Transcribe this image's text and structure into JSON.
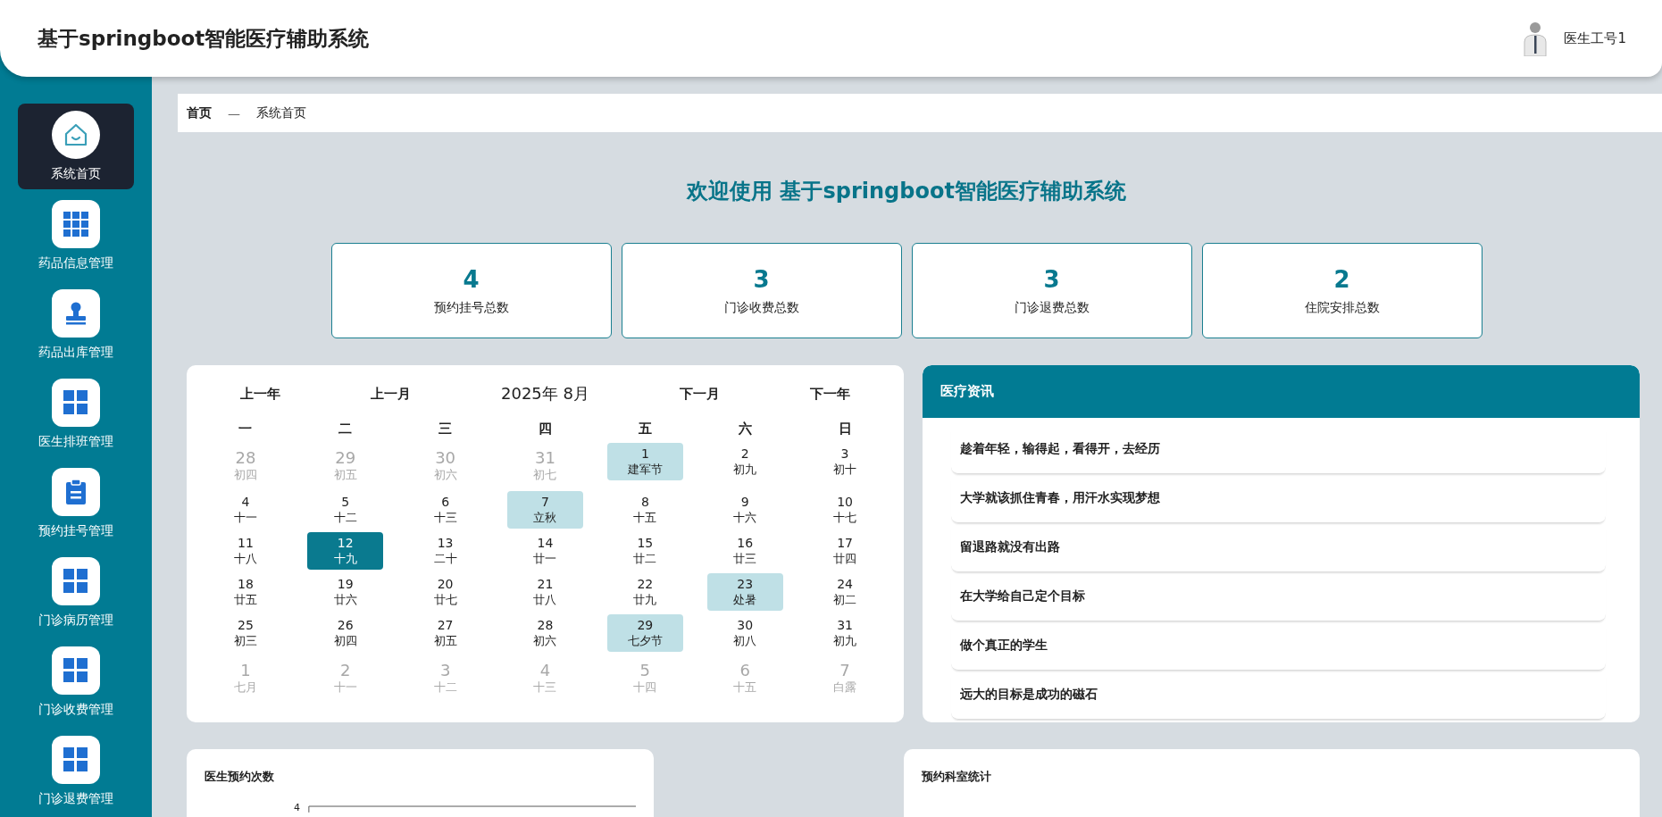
{
  "header": {
    "title": "基于springboot智能医疗辅助系统",
    "user": "医生工号1"
  },
  "sidebar": {
    "items": [
      {
        "label": "系统首页",
        "kind": "home",
        "selected": true
      },
      {
        "label": "药品信息管理",
        "kind": "grid9",
        "selected": false
      },
      {
        "label": "药品出库管理",
        "kind": "stamp",
        "selected": false
      },
      {
        "label": "医生排班管理",
        "kind": "grid4",
        "selected": false
      },
      {
        "label": "预约挂号管理",
        "kind": "clipboard",
        "selected": false
      },
      {
        "label": "门诊病历管理",
        "kind": "grid4",
        "selected": false
      },
      {
        "label": "门诊收费管理",
        "kind": "grid4",
        "selected": false
      },
      {
        "label": "门诊退费管理",
        "kind": "grid4",
        "selected": false
      }
    ]
  },
  "breadcrumb": {
    "current": "首页",
    "separator": "—",
    "page": "系统首页"
  },
  "welcome": "欢迎使用 基于springboot智能医疗辅助系统",
  "stats": [
    {
      "value": "4",
      "label": "预约挂号总数"
    },
    {
      "value": "3",
      "label": "门诊收费总数"
    },
    {
      "value": "3",
      "label": "门诊退费总数"
    },
    {
      "value": "2",
      "label": "住院安排总数"
    }
  ],
  "calendar": {
    "prev_year": "上一年",
    "prev_month": "上一月",
    "month": "2025年 8月",
    "next_month": "下一月",
    "next_year": "下一年",
    "weekdays": [
      "一",
      "二",
      "三",
      "四",
      "五",
      "六",
      "日"
    ],
    "days": [
      {
        "day": "28",
        "lunar": "初四",
        "muted": true,
        "festival": false,
        "selected": false
      },
      {
        "day": "29",
        "lunar": "初五",
        "muted": true,
        "festival": false,
        "selected": false
      },
      {
        "day": "30",
        "lunar": "初六",
        "muted": true,
        "festival": false,
        "selected": false
      },
      {
        "day": "31",
        "lunar": "初七",
        "muted": true,
        "festival": false,
        "selected": false
      },
      {
        "day": "1",
        "lunar": "建军节",
        "muted": false,
        "festival": true,
        "selected": false
      },
      {
        "day": "2",
        "lunar": "初九",
        "muted": false,
        "festival": false,
        "selected": false
      },
      {
        "day": "3",
        "lunar": "初十",
        "muted": false,
        "festival": false,
        "selected": false
      },
      {
        "day": "4",
        "lunar": "十一",
        "muted": false,
        "festival": false,
        "selected": false
      },
      {
        "day": "5",
        "lunar": "十二",
        "muted": false,
        "festival": false,
        "selected": false
      },
      {
        "day": "6",
        "lunar": "十三",
        "muted": false,
        "festival": false,
        "selected": false
      },
      {
        "day": "7",
        "lunar": "立秋",
        "muted": false,
        "festival": true,
        "selected": false
      },
      {
        "day": "8",
        "lunar": "十五",
        "muted": false,
        "festival": false,
        "selected": false
      },
      {
        "day": "9",
        "lunar": "十六",
        "muted": false,
        "festival": false,
        "selected": false
      },
      {
        "day": "10",
        "lunar": "十七",
        "muted": false,
        "festival": false,
        "selected": false
      },
      {
        "day": "11",
        "lunar": "十八",
        "muted": false,
        "festival": false,
        "selected": false
      },
      {
        "day": "12",
        "lunar": "十九",
        "muted": false,
        "festival": false,
        "selected": true
      },
      {
        "day": "13",
        "lunar": "二十",
        "muted": false,
        "festival": false,
        "selected": false
      },
      {
        "day": "14",
        "lunar": "廿一",
        "muted": false,
        "festival": false,
        "selected": false
      },
      {
        "day": "15",
        "lunar": "廿二",
        "muted": false,
        "festival": false,
        "selected": false
      },
      {
        "day": "16",
        "lunar": "廿三",
        "muted": false,
        "festival": false,
        "selected": false
      },
      {
        "day": "17",
        "lunar": "廿四",
        "muted": false,
        "festival": false,
        "selected": false
      },
      {
        "day": "18",
        "lunar": "廿五",
        "muted": false,
        "festival": false,
        "selected": false
      },
      {
        "day": "19",
        "lunar": "廿六",
        "muted": false,
        "festival": false,
        "selected": false
      },
      {
        "day": "20",
        "lunar": "廿七",
        "muted": false,
        "festival": false,
        "selected": false
      },
      {
        "day": "21",
        "lunar": "廿八",
        "muted": false,
        "festival": false,
        "selected": false
      },
      {
        "day": "22",
        "lunar": "廿九",
        "muted": false,
        "festival": false,
        "selected": false
      },
      {
        "day": "23",
        "lunar": "处暑",
        "muted": false,
        "festival": true,
        "selected": false
      },
      {
        "day": "24",
        "lunar": "初二",
        "muted": false,
        "festival": false,
        "selected": false
      },
      {
        "day": "25",
        "lunar": "初三",
        "muted": false,
        "festival": false,
        "selected": false
      },
      {
        "day": "26",
        "lunar": "初四",
        "muted": false,
        "festival": false,
        "selected": false
      },
      {
        "day": "27",
        "lunar": "初五",
        "muted": false,
        "festival": false,
        "selected": false
      },
      {
        "day": "28",
        "lunar": "初六",
        "muted": false,
        "festival": false,
        "selected": false
      },
      {
        "day": "29",
        "lunar": "七夕节",
        "muted": false,
        "festival": true,
        "selected": false
      },
      {
        "day": "30",
        "lunar": "初八",
        "muted": false,
        "festival": false,
        "selected": false
      },
      {
        "day": "31",
        "lunar": "初九",
        "muted": false,
        "festival": false,
        "selected": false
      },
      {
        "day": "1",
        "lunar": "七月",
        "muted": true,
        "festival": false,
        "selected": false
      },
      {
        "day": "2",
        "lunar": "十一",
        "muted": true,
        "festival": false,
        "selected": false
      },
      {
        "day": "3",
        "lunar": "十二",
        "muted": true,
        "festival": false,
        "selected": false
      },
      {
        "day": "4",
        "lunar": "十三",
        "muted": true,
        "festival": false,
        "selected": false
      },
      {
        "day": "5",
        "lunar": "十四",
        "muted": true,
        "festival": false,
        "selected": false
      },
      {
        "day": "6",
        "lunar": "十五",
        "muted": true,
        "festival": false,
        "selected": false
      },
      {
        "day": "7",
        "lunar": "白露",
        "muted": true,
        "festival": false,
        "selected": false
      }
    ]
  },
  "news": {
    "title": "医疗资讯",
    "items": [
      "趁着年轻，输得起，看得开，去经历",
      "大学就该抓住青春，用汗水实现梦想",
      "留退路就没有出路",
      "在大学给自己定个目标",
      "做个真正的学生",
      "远大的目标是成功的磁石"
    ]
  },
  "charts": [
    {
      "title": "医生预约次数",
      "tick": "4"
    },
    {
      "title": "预约科室统计"
    }
  ]
}
